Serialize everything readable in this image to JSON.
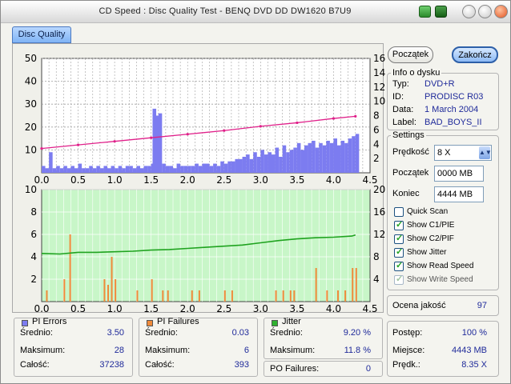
{
  "window": {
    "title": "CD Speed : Disc Quality Test - BENQ    DVD DD DW1620    B7U9"
  },
  "tabs": [
    {
      "label": "Disc Quality"
    }
  ],
  "buttons": {
    "start": "Początek",
    "stop": "Zakończ"
  },
  "disc_info": {
    "title": "Info o dysku",
    "rows": [
      {
        "label": "Typ:",
        "value": "DVD+R"
      },
      {
        "label": "ID:",
        "value": "PRODISC R03"
      },
      {
        "label": "Data:",
        "value": "1 March 2004"
      },
      {
        "label": "Label:",
        "value": "BAD_BOYS_II"
      }
    ]
  },
  "settings": {
    "title": "Settings",
    "speed_label": "Prędkość",
    "speed_value": "8 X",
    "start_label": "Początek",
    "start_value": "0000 MB",
    "end_label": "Koniec",
    "end_value": "4444 MB",
    "checkboxes": [
      {
        "label": "Quick Scan",
        "checked": false,
        "disabled": false
      },
      {
        "label": "Show C1/PIE",
        "checked": true,
        "disabled": false
      },
      {
        "label": "Show C2/PIF",
        "checked": true,
        "disabled": false
      },
      {
        "label": "Show Jitter",
        "checked": true,
        "disabled": false
      },
      {
        "label": "Show Read Speed",
        "checked": true,
        "disabled": false
      },
      {
        "label": "Show Write Speed",
        "checked": true,
        "disabled": true
      }
    ]
  },
  "quality": {
    "label": "Ocena jakość",
    "value": "97"
  },
  "progress": {
    "rows": [
      {
        "label": "Postęp:",
        "value": "100 %"
      },
      {
        "label": "Miejsce:",
        "value": "4443 MB"
      },
      {
        "label": "Prędk.:",
        "value": "8.35 X"
      }
    ]
  },
  "stats": {
    "pi_errors": {
      "title": "PI Errors",
      "color": "#7c7cf0",
      "avg_label": "Średnio:",
      "avg": "3.50",
      "max_label": "Maksimum:",
      "max": "28",
      "total_label": "Całość:",
      "total": "37238"
    },
    "pi_failures": {
      "title": "PI Failures",
      "color": "#ef8a3a",
      "avg_label": "Średnio:",
      "avg": "0.03",
      "max_label": "Maksimum:",
      "max": "6",
      "total_label": "Całość:",
      "total": "393"
    },
    "jitter": {
      "title": "Jitter",
      "color": "#2fb02f",
      "avg_label": "Średnio:",
      "avg": "9.20 %",
      "max_label": "Maksimum:",
      "max": "11.8 %",
      "po_label": "PO Failures:",
      "po": "0"
    }
  },
  "chart_data": [
    {
      "type": "bar",
      "x_ticks": [
        "0.0",
        "0.5",
        "1.0",
        "1.5",
        "2.0",
        "2.5",
        "3.0",
        "3.5",
        "4.0",
        "4.5"
      ],
      "y_left_ticks": [
        "10",
        "20",
        "30",
        "40",
        "50"
      ],
      "y_right_ticks": [
        "2",
        "4",
        "6",
        "8",
        "10",
        "12",
        "14",
        "16"
      ],
      "xlim": [
        0,
        4.5
      ],
      "ylim_left": [
        0,
        50
      ],
      "ylim_right": [
        0,
        16
      ],
      "series": [
        {
          "kind": "bars",
          "color": "#7c7cf0",
          "x": [
            0.0,
            0.05,
            0.1,
            0.15,
            0.2,
            0.25,
            0.3,
            0.35,
            0.4,
            0.45,
            0.5,
            0.55,
            0.6,
            0.65,
            0.7,
            0.75,
            0.8,
            0.85,
            0.9,
            0.95,
            1.0,
            1.05,
            1.1,
            1.15,
            1.2,
            1.25,
            1.3,
            1.35,
            1.4,
            1.45,
            1.5,
            1.52,
            1.54,
            1.56,
            1.58,
            1.6,
            1.65,
            1.7,
            1.75,
            1.8,
            1.85,
            1.9,
            1.95,
            2.0,
            2.05,
            2.1,
            2.15,
            2.2,
            2.25,
            2.3,
            2.35,
            2.4,
            2.45,
            2.5,
            2.55,
            2.6,
            2.65,
            2.7,
            2.75,
            2.8,
            2.85,
            2.9,
            2.95,
            3.0,
            3.05,
            3.1,
            3.15,
            3.2,
            3.25,
            3.3,
            3.35,
            3.4,
            3.45,
            3.5,
            3.55,
            3.6,
            3.65,
            3.7,
            3.75,
            3.8,
            3.85,
            3.9,
            3.95,
            4.0,
            4.05,
            4.1,
            4.15,
            4.2,
            4.25,
            4.3
          ],
          "y": [
            3,
            2,
            9,
            2,
            3,
            2,
            3,
            2,
            3,
            2,
            4,
            2,
            2,
            3,
            2,
            3,
            2,
            3,
            2,
            3,
            2,
            3,
            2,
            3,
            3,
            2,
            3,
            2,
            3,
            3,
            4,
            28,
            12,
            25,
            18,
            26,
            4,
            3,
            3,
            2,
            4,
            3,
            3,
            3,
            3,
            4,
            3,
            4,
            4,
            3,
            4,
            3,
            5,
            4,
            5,
            5,
            6,
            6,
            7,
            8,
            6,
            9,
            7,
            10,
            8,
            9,
            8,
            11,
            7,
            12,
            9,
            10,
            11,
            13,
            10,
            12,
            13,
            14,
            11,
            13,
            12,
            14,
            13,
            15,
            12,
            14,
            13,
            15,
            16,
            17
          ]
        },
        {
          "kind": "line",
          "axis": "right",
          "color": "#e0208a",
          "x": [
            0.0,
            0.5,
            1.0,
            1.5,
            2.0,
            2.5,
            3.0,
            3.5,
            4.0,
            4.3
          ],
          "y": [
            3.4,
            3.9,
            4.4,
            4.9,
            5.4,
            5.9,
            6.5,
            7.0,
            7.6,
            7.9
          ]
        }
      ]
    },
    {
      "type": "bar",
      "x_ticks": [
        "0.0",
        "0.5",
        "1.0",
        "1.5",
        "2.0",
        "2.5",
        "3.0",
        "3.5",
        "4.0",
        "4.5"
      ],
      "y_left_ticks": [
        "2",
        "4",
        "6",
        "8",
        "10"
      ],
      "y_right_ticks": [
        "4",
        "8",
        "12",
        "16",
        "20"
      ],
      "xlim": [
        0,
        4.5
      ],
      "ylim_left": [
        0,
        10
      ],
      "ylim_right": [
        0,
        20
      ],
      "series": [
        {
          "kind": "bars",
          "color": "#ef8a3a",
          "x": [
            0.06,
            0.3,
            0.38,
            0.85,
            0.9,
            0.95,
            1.0,
            1.3,
            1.5,
            1.65,
            1.72,
            2.05,
            2.15,
            2.5,
            2.6,
            3.2,
            3.3,
            3.4,
            3.45,
            3.75,
            3.9,
            4.05,
            4.15,
            4.25,
            4.3
          ],
          "y": [
            1,
            2,
            6,
            2,
            1.5,
            4,
            2,
            1,
            2,
            1,
            1,
            1,
            1,
            1,
            1,
            1,
            1,
            1,
            1,
            3,
            1,
            1,
            1,
            3,
            3
          ]
        },
        {
          "kind": "line",
          "axis": "right",
          "color": "#1fa31f",
          "x": [
            0.0,
            0.25,
            0.5,
            0.75,
            1.0,
            1.25,
            1.5,
            1.75,
            2.0,
            2.25,
            2.5,
            2.75,
            3.0,
            3.25,
            3.5,
            3.75,
            4.0,
            4.25,
            4.3
          ],
          "y": [
            8.6,
            8.5,
            8.8,
            8.8,
            8.9,
            9.0,
            9.2,
            9.3,
            9.5,
            9.7,
            9.9,
            10.1,
            10.5,
            10.9,
            11.2,
            11.4,
            11.5,
            11.7,
            11.9
          ]
        }
      ]
    }
  ]
}
